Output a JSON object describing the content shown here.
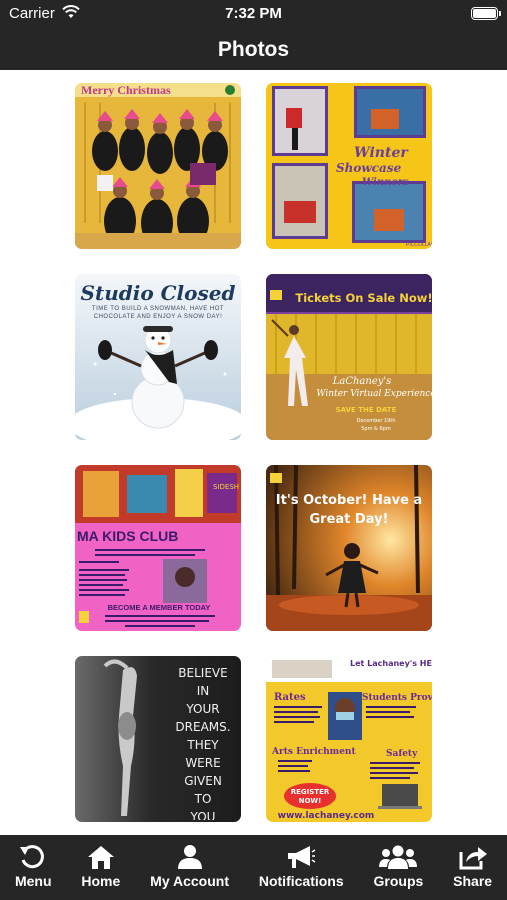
{
  "status_bar": {
    "carrier": "Carrier",
    "time": "7:32 PM"
  },
  "nav": {
    "title": "Photos"
  },
  "photos": [
    {
      "caption": "Merry Christmas",
      "bg": "#e6b73a"
    },
    {
      "caption": "Winter Showcase Winners",
      "bg": "#f5c518"
    },
    {
      "caption": "Studio Closed",
      "subcaption": "TIME TO BUILD A SNOWMAN, HAVE HOT CHOCOLATE AND ENJOY A SNOW DAY!",
      "bg": "#dce6ef"
    },
    {
      "caption": "Tickets On Sale Now!",
      "subcaption": "SAVE THE DATE",
      "bg": "#7a3fa0"
    },
    {
      "caption": "MA KIDS CLUB",
      "subcaption": "BECOME A MEMBER TODAY",
      "bg": "#f062c4"
    },
    {
      "caption": "It's October! Have a Great Day!",
      "bg": "#9a5a1c"
    },
    {
      "caption": "BELIEVE IN YOUR DREAMS. THEY WERE GIVEN TO YOU FOR A REASON.",
      "bg": "#262626"
    },
    {
      "caption": "Let Lachaney's HELP!",
      "subcaption": "www.lachaney.com",
      "bg": "#f3c82a"
    }
  ],
  "tab_bar": [
    {
      "label": "Menu",
      "icon": "menu-back-icon"
    },
    {
      "label": "Home",
      "icon": "home-icon"
    },
    {
      "label": "My Account",
      "icon": "person-icon"
    },
    {
      "label": "Notifications",
      "icon": "megaphone-icon"
    },
    {
      "label": "Groups",
      "icon": "group-icon"
    },
    {
      "label": "Share",
      "icon": "share-icon"
    }
  ]
}
